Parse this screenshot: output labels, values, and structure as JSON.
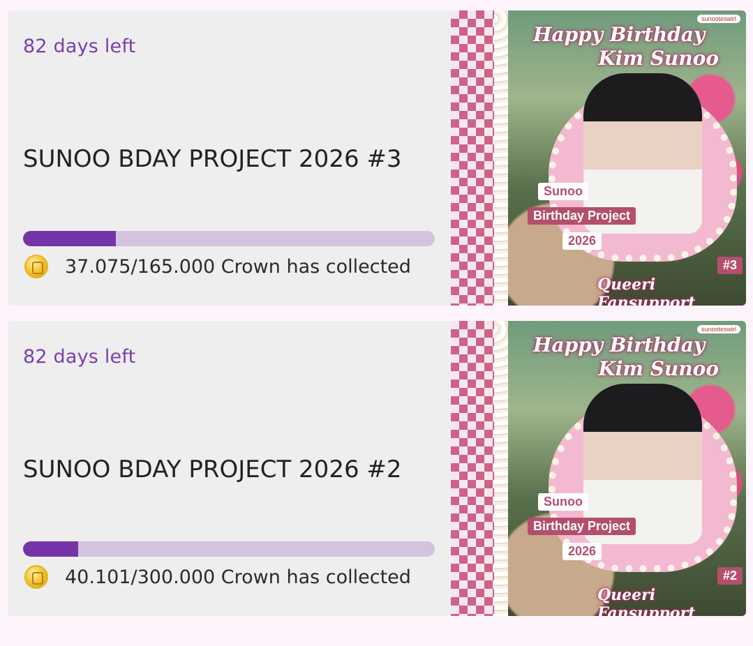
{
  "projects": [
    {
      "days_left": "82 days left",
      "title": "SUNOO BDAY PROJECT 2026 #3",
      "progress": 0.2247,
      "collected": "37.075/165.000 Crown has collected",
      "banner": {
        "handle": "sunooteswirl",
        "greeting_line1": "Happy Birthday",
        "greeting_line2": "Kim Sunoo",
        "tag_name": "Sunoo",
        "tag_project": "Birthday Project",
        "tag_year": "2026",
        "tag_number": "#3",
        "fansupport": "Queeri Fansupport"
      }
    },
    {
      "days_left": "82 days left",
      "title": "SUNOO BDAY PROJECT 2026 #2",
      "progress": 0.1337,
      "collected": "40.101/300.000 Crown has collected",
      "banner": {
        "handle": "sunooteswirl",
        "greeting_line1": "Happy Birthday",
        "greeting_line2": "Kim Sunoo",
        "tag_name": "Sunoo",
        "tag_project": "Birthday Project",
        "tag_year": "2026",
        "tag_number": "#2",
        "fansupport": "Queeri Fansupport"
      }
    }
  ],
  "colors": {
    "accent": "#7434a8",
    "track": "#d3c3df",
    "card_bg": "#eeeeee",
    "page_bg": "#fdf5fb"
  },
  "icons": {
    "currency": "crown-coin-icon"
  }
}
